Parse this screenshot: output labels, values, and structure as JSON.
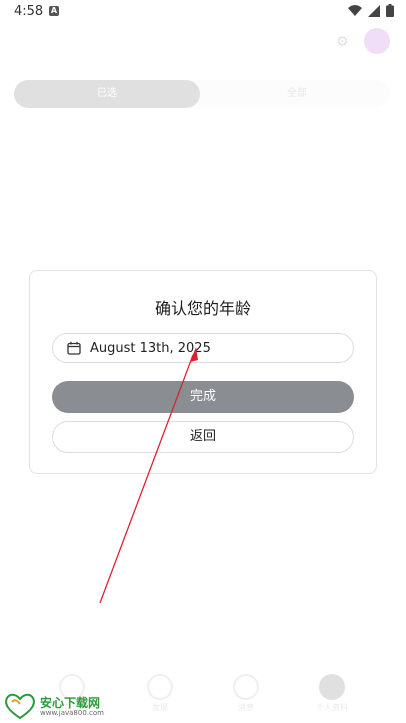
{
  "status": {
    "time": "4:58",
    "a_glyph": "A"
  },
  "background": {
    "tab_active": "已选",
    "tab_inactive": "全部",
    "nav": [
      {
        "label": "首页"
      },
      {
        "label": "发现"
      },
      {
        "label": "消息"
      },
      {
        "label": "个人资料"
      }
    ]
  },
  "dialog": {
    "title": "确认您的年龄",
    "date_value": "August 13th, 2025",
    "done_label": "完成",
    "back_label": "返回"
  },
  "watermark": {
    "name": "安心下载网",
    "url": "www.java800.com"
  },
  "colors": {
    "done_button": "#8a8d91",
    "arrow": "#d9232d",
    "avatar": "#c06be0",
    "watermark_green": "#2a9a3c"
  }
}
